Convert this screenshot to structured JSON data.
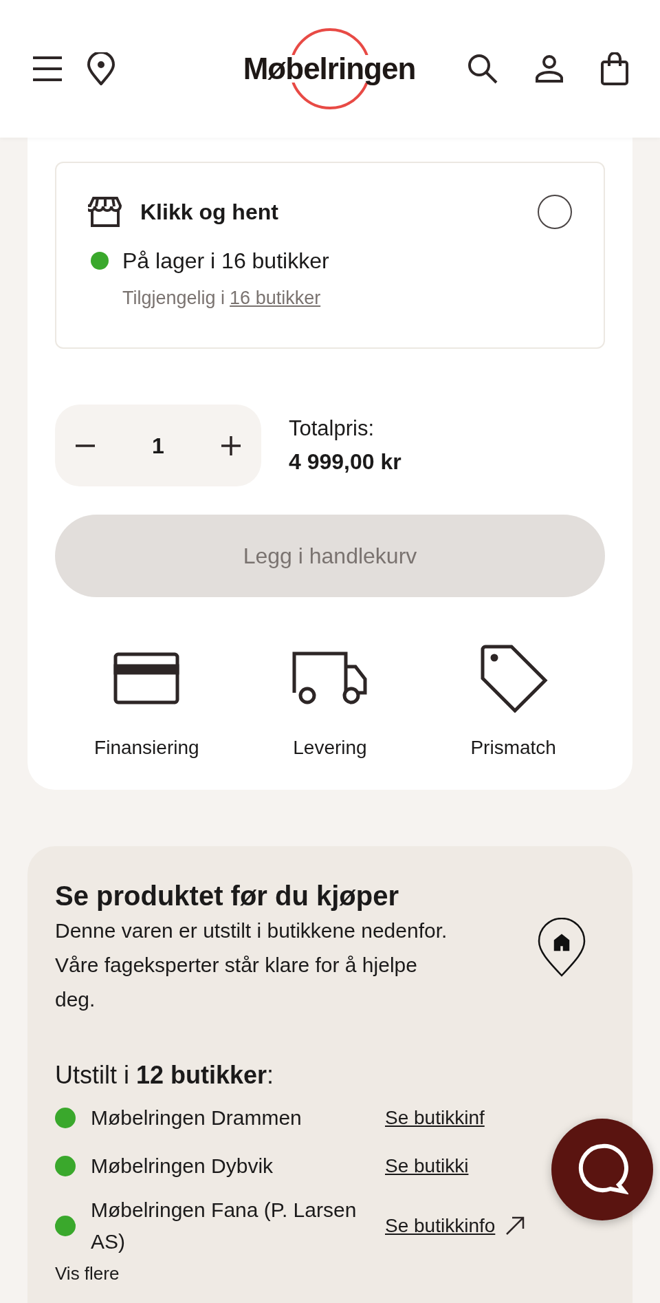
{
  "header": {
    "logo": "Møbelringen"
  },
  "pickup": {
    "title": "Klikk og hent",
    "selected": false,
    "stock": {
      "text": "På lager i 16 butikker",
      "color": "#3aa82c"
    },
    "availability": {
      "prefix": "Tilgjengelig i",
      "link": "16 butikker"
    }
  },
  "quantity": {
    "value": "1"
  },
  "total": {
    "label": "Totalpris:",
    "amount": "4 999,00 kr"
  },
  "cart_button": {
    "label": "Legg i handlekurv",
    "disabled": true
  },
  "features": [
    {
      "kind": "card",
      "label": "Finansiering"
    },
    {
      "kind": "truck",
      "label": "Levering"
    },
    {
      "kind": "tag",
      "label": "Prismatch"
    }
  ],
  "showroom": {
    "title": "Se produktet før du kjøper",
    "text": "Denne varen er utstilt i butikkene nedenfor. Våre fageksperter står klare for å hjelpe deg.",
    "count": "Utstilt i **12 butikker**:",
    "stores": [
      {
        "name": "Møbelringen Drammen",
        "link": "Se butikkinf",
        "color": "#3aa82c",
        "arrow": false
      },
      {
        "name": "Møbelringen Dybvik",
        "link": "Se butikki",
        "color": "#3aa82c",
        "arrow": false
      },
      {
        "name": "Møbelringen Fana (P. Larsen AS)",
        "link": "Se butikkinfo",
        "color": "#3aa82c",
        "arrow": true
      }
    ],
    "more": "Vis flere"
  }
}
